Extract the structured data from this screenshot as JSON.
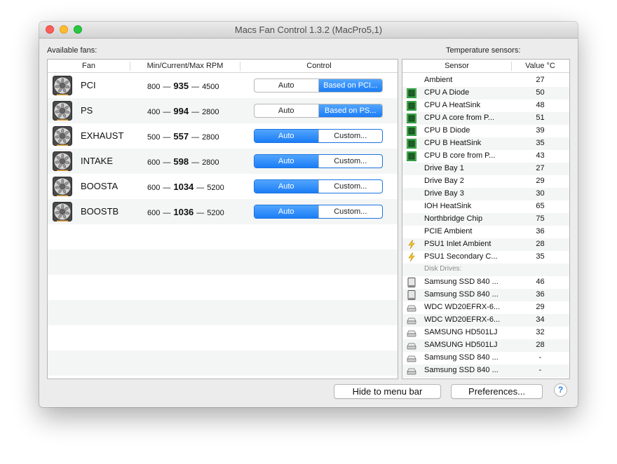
{
  "window": {
    "title": "Macs Fan Control 1.3.2 (MacPro5,1)"
  },
  "fans_panel": {
    "label": "Available fans:",
    "headers": {
      "fan": "Fan",
      "rpm": "Min/Current/Max RPM",
      "control": "Control"
    },
    "fans": [
      {
        "name": "PCI",
        "min": "800",
        "current": "935",
        "max": "4500",
        "left": "Auto",
        "right": "Based on PCI...",
        "selected": "right"
      },
      {
        "name": "PS",
        "min": "400",
        "current": "994",
        "max": "2800",
        "left": "Auto",
        "right": "Based on PS...",
        "selected": "right"
      },
      {
        "name": "EXHAUST",
        "min": "500",
        "current": "557",
        "max": "2800",
        "left": "Auto",
        "right": "Custom...",
        "selected": "left"
      },
      {
        "name": "INTAKE",
        "min": "600",
        "current": "598",
        "max": "2800",
        "left": "Auto",
        "right": "Custom...",
        "selected": "left"
      },
      {
        "name": "BOOSTA",
        "min": "600",
        "current": "1034",
        "max": "5200",
        "left": "Auto",
        "right": "Custom...",
        "selected": "left"
      },
      {
        "name": "BOOSTB",
        "min": "600",
        "current": "1036",
        "max": "5200",
        "left": "Auto",
        "right": "Custom...",
        "selected": "left"
      }
    ],
    "dash": "—"
  },
  "sensors_panel": {
    "label": "Temperature sensors:",
    "headers": {
      "sensor": "Sensor",
      "value": "Value °C"
    },
    "sensors": [
      {
        "name": "Ambient",
        "value": "27",
        "icon": "none"
      },
      {
        "name": "CPU A Diode",
        "value": "50",
        "icon": "cpu-chip-icon"
      },
      {
        "name": "CPU A HeatSink",
        "value": "48",
        "icon": "cpu-chip-icon"
      },
      {
        "name": "CPU A core from P...",
        "value": "51",
        "icon": "cpu-chip-icon"
      },
      {
        "name": "CPU B Diode",
        "value": "39",
        "icon": "cpu-chip-icon"
      },
      {
        "name": "CPU B HeatSink",
        "value": "35",
        "icon": "cpu-chip-icon"
      },
      {
        "name": "CPU B core from P...",
        "value": "43",
        "icon": "cpu-chip-icon"
      },
      {
        "name": "Drive Bay 1",
        "value": "27",
        "icon": "none"
      },
      {
        "name": "Drive Bay 2",
        "value": "29",
        "icon": "none"
      },
      {
        "name": "Drive Bay 3",
        "value": "30",
        "icon": "none"
      },
      {
        "name": "IOH HeatSink",
        "value": "65",
        "icon": "none"
      },
      {
        "name": "Northbridge Chip",
        "value": "75",
        "icon": "none"
      },
      {
        "name": "PCIE Ambient",
        "value": "36",
        "icon": "none"
      },
      {
        "name": "PSU1 Inlet Ambient",
        "value": "28",
        "icon": "lightning-icon"
      },
      {
        "name": "PSU1 Secondary C...",
        "value": "35",
        "icon": "lightning-icon"
      }
    ],
    "disk_label": "Disk Drives:",
    "disks": [
      {
        "name": "Samsung SSD 840 ...",
        "value": "46",
        "icon": "ssd-icon"
      },
      {
        "name": "Samsung SSD 840 ...",
        "value": "36",
        "icon": "ssd-icon"
      },
      {
        "name": "WDC WD20EFRX-6...",
        "value": "29",
        "icon": "hard-drive-icon"
      },
      {
        "name": "WDC WD20EFRX-6...",
        "value": "34",
        "icon": "hard-drive-icon"
      },
      {
        "name": "SAMSUNG HD501LJ",
        "value": "32",
        "icon": "hard-drive-icon"
      },
      {
        "name": "SAMSUNG HD501LJ",
        "value": "28",
        "icon": "hard-drive-icon"
      },
      {
        "name": "Samsung SSD 840 ...",
        "value": "-",
        "icon": "hard-drive-icon"
      },
      {
        "name": "Samsung SSD 840 ...",
        "value": "-",
        "icon": "hard-drive-icon"
      }
    ]
  },
  "footer": {
    "hide_label": "Hide to menu bar",
    "prefs_label": "Preferences...",
    "help_label": "?"
  }
}
